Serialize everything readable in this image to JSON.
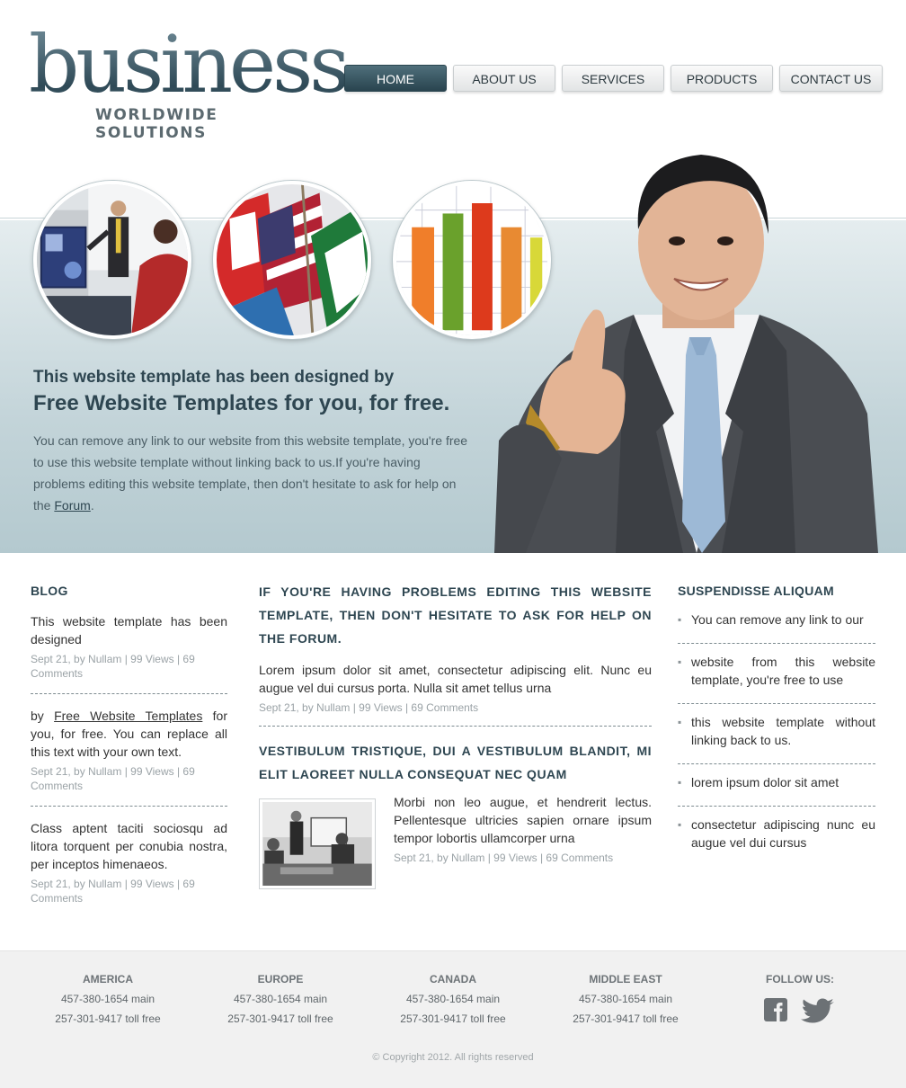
{
  "header": {
    "logo_word": "business",
    "logo_tagline": "WORLDWIDE SOLUTIONS",
    "nav": [
      {
        "label": "HOME",
        "active": true
      },
      {
        "label": "ABOUT US",
        "active": false
      },
      {
        "label": "SERVICES",
        "active": false
      },
      {
        "label": "PRODUCTS",
        "active": false
      },
      {
        "label": "CONTACT US",
        "active": false
      }
    ]
  },
  "hero": {
    "title_line1": "This website template has been designed by",
    "title_line2": "Free Website Templates for you, for free.",
    "text_before_link": "You can remove any link to our website from this website template, you're free to use this website template without linking back to us.If you're having problems editing this website template, then don't hesitate to ask for help on the ",
    "link_label": "Forum",
    "text_after_link": "."
  },
  "blog": {
    "title": "BLOG",
    "posts": [
      {
        "text": "This website template has been designed",
        "meta": "Sept 21, by Nullam | 99 Views | 69 Comments"
      },
      {
        "text_before_link": "by ",
        "link_label": "Free Website Templates",
        "text_after_link": " for you, for free. You can replace all this text with your own text.",
        "meta": "Sept 21, by Nullam | 99 Views | 69 Comments"
      },
      {
        "text": "Class aptent taciti sociosqu ad litora torquent per conubia nostra, per inceptos himenaeos.",
        "meta": "Sept 21, by Nullam | 99 Views | 69 Comments"
      }
    ]
  },
  "main": {
    "section1": {
      "title": "IF YOU'RE HAVING PROBLEMS EDITING THIS WEBSITE TEMPLATE, THEN DON'T HESITATE TO ASK FOR HELP ON THE FORUM.",
      "text": "Lorem ipsum dolor sit amet, consectetur adipiscing elit. Nunc eu augue vel dui cursus porta. Nulla sit amet tellus urna",
      "meta": "Sept 21, by Nullam | 99 Views | 69 Comments"
    },
    "section2": {
      "title": "VESTIBULUM TRISTIQUE, DUI A VESTIBULUM BLANDIT, MI ELIT LAOREET NULLA CONSEQUAT NEC QUAM",
      "text": "Morbi non leo augue, et hendrerit lectus. Pellentesque ultricies sapien ornare ipsum tempor lobortis ullamcorper urna",
      "meta": "Sept 21, by Nullam | 99 Views | 69 Comments"
    }
  },
  "sidebar": {
    "title": "SUSPENDISSE ALIQUAM",
    "items": [
      "You can remove any link to our",
      "website from this website template, you're free to use",
      "this website template without linking back to us.",
      "lorem ipsum dolor sit amet",
      "consectetur adipiscing nunc eu augue vel dui cursus"
    ]
  },
  "footer": {
    "offices": [
      {
        "name": "AMERICA",
        "main": "457-380-1654 main",
        "tollfree": "257-301-9417 toll free"
      },
      {
        "name": "EUROPE",
        "main": "457-380-1654 main",
        "tollfree": "257-301-9417 toll free"
      },
      {
        "name": "CANADA",
        "main": "457-380-1654 main",
        "tollfree": "257-301-9417 toll free"
      },
      {
        "name": "MIDDLE EAST",
        "main": "457-380-1654 main",
        "tollfree": "257-301-9417 toll free"
      }
    ],
    "follow_label": "FOLLOW US:",
    "social_icons": [
      "facebook-icon",
      "twitter-icon"
    ],
    "copyright": "© Copyright 2012. All rights reserved"
  },
  "colors": {
    "brand_dark": "#2e4651",
    "hero_band": "#c3d4d9",
    "footer_bg": "#f1f1f1"
  }
}
